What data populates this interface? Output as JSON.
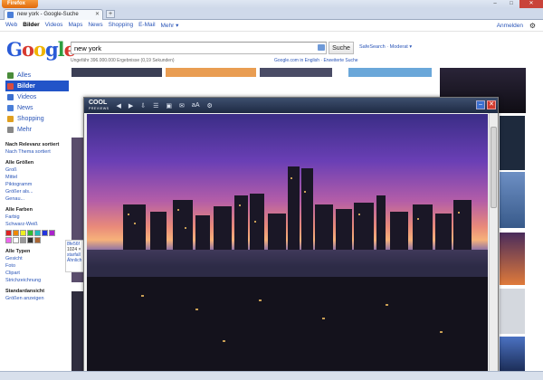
{
  "browser": {
    "menu_button": "Firefox",
    "tab_title": "new york - Google-Suche",
    "new_tab": "+",
    "window_controls": [
      "–",
      "□",
      "✕"
    ]
  },
  "gbar": {
    "links": [
      "Web",
      "Bilder",
      "Videos",
      "Maps",
      "News",
      "Shopping",
      "E-Mail",
      "Mehr ▾"
    ],
    "active": "Bilder",
    "signin": "Anmelden"
  },
  "logo": {
    "letters": [
      "G",
      "o",
      "o",
      "g",
      "l",
      "e"
    ],
    "colors": [
      "#2a5bd7",
      "#d73a31",
      "#f0b400",
      "#2a5bd7",
      "#2f9e41",
      "#d73a31"
    ]
  },
  "search": {
    "query": "new york",
    "button": "Suche",
    "safesearch": "SafeSearch · Moderat ▾",
    "results": "Ungefähr 396.000.000 Ergebnisse (0,19 Sekunden)",
    "english_link": "Google.com in English · Erweiterte Suche"
  },
  "sidebar": {
    "nav": [
      {
        "label": "Alles",
        "icon": "web-icon",
        "color": "#4a8c3a"
      },
      {
        "label": "Bilder",
        "icon": "images-icon",
        "color": "#d94b3f",
        "selected": true
      },
      {
        "label": "Videos",
        "icon": "videos-icon",
        "color": "#3b6fd0"
      },
      {
        "label": "News",
        "icon": "news-icon",
        "color": "#4a7ed8"
      },
      {
        "label": "Shopping",
        "icon": "shopping-icon",
        "color": "#e0a020"
      },
      {
        "label": "Mehr",
        "icon": "more-icon",
        "color": "#888888"
      }
    ],
    "sort_heading": "Nach Relevanz sortiert",
    "sort_link": "Nach Thema sortiert",
    "size_heading": "Alle Größen",
    "sizes": [
      "Groß",
      "Mittel",
      "Piktogramm",
      "Größer als...",
      "Genau..."
    ],
    "color_heading": "Alle Farben",
    "colors_links": [
      "Farbig",
      "Schwarz-Weiß"
    ],
    "swatches": [
      "#d22",
      "#e80",
      "#ee2",
      "#3b3",
      "#2bb",
      "#23d",
      "#a2c",
      "#e6e",
      "#fff",
      "#999",
      "#333",
      "#a63"
    ],
    "type_heading": "Alle Typen",
    "types": [
      "Gesicht",
      "Foto",
      "Clipart",
      "Strichzeichnung"
    ],
    "view_heading": "Standardansicht",
    "view_link": "Größen anzeigen"
  },
  "popup_info": {
    "link": "8fe56f",
    "size": "1024 ×",
    "line1": "starfall",
    "line2": "Ähnlich"
  },
  "viewer": {
    "logo_top": "COOL",
    "logo_bottom": "PREVIEWS",
    "toolbar_icons": [
      "◀",
      "▶",
      "⇩",
      "☰",
      "▣",
      "✉",
      "aA",
      "⚙"
    ],
    "minimize": "–",
    "close": "✕"
  }
}
